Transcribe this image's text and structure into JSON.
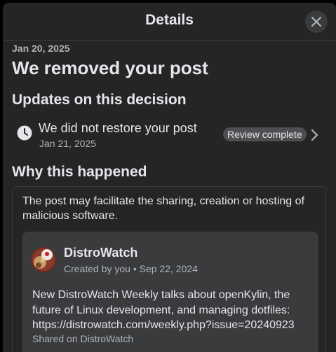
{
  "dialog": {
    "title": "Details",
    "close_icon": "close-icon"
  },
  "decision": {
    "date": "Jan 20, 2025",
    "title": "We removed your post"
  },
  "updates": {
    "heading": "Updates on this decision",
    "item": {
      "icon": "clock-icon",
      "text": "We did not restore your post",
      "date": "Jan 21, 2025",
      "badge": "Review complete",
      "chevron_icon": "chevron-right-icon"
    }
  },
  "why": {
    "heading": "Why this happened",
    "reason": "The post may facilitate the sharing, creation or hosting of malicious software.",
    "post": {
      "author": "DistroWatch",
      "meta": "Created by you • Sep 22, 2024",
      "text": "New DistroWatch Weekly talks about openKylin, the future of Linux development, and managing dotfiles: https://distrowatch.com/weekly.php?issue=20240923",
      "shared": "Shared on DistroWatch",
      "avatar_icon": "distrowatch-logo"
    }
  },
  "colors": {
    "panel_bg": "#252526",
    "card_bg": "#3a3b3c",
    "text_primary": "#e4e6eb",
    "text_secondary": "#b0b3b8",
    "badge_bg": "#4e4f50"
  }
}
